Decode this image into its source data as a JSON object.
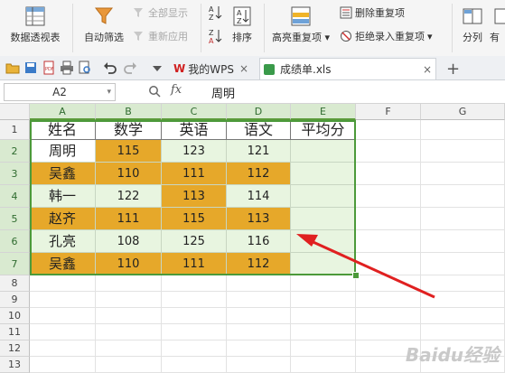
{
  "ribbon": {
    "pivot_label": "数据透视表",
    "autofilter_label": "自动筛选",
    "show_all_label": "全部显示",
    "reapply_label": "重新应用",
    "sort_label": "排序",
    "highlight_dup_label": "高亮重复项",
    "delete_dup_label": "删除重复项",
    "reject_dup_label": "拒绝录入重复项",
    "split_label": "分列",
    "truncated_label": "有"
  },
  "tabs": {
    "wps_tab": "我的WPS",
    "file_tab": "成绩单.xls",
    "file_close": "×",
    "wps_close": "×",
    "new_tab": "+"
  },
  "formula_bar": {
    "name_box": "A2",
    "fx": "fx",
    "value": "周明"
  },
  "columns": [
    "A",
    "B",
    "C",
    "D",
    "E",
    "F",
    "G"
  ],
  "rows": [
    "1",
    "2",
    "3",
    "4",
    "5",
    "6",
    "7",
    "8",
    "9",
    "10",
    "11",
    "12",
    "13"
  ],
  "sheet": {
    "header": [
      "姓名",
      "数学",
      "英语",
      "语文",
      "平均分"
    ],
    "data": [
      [
        "周明",
        "115",
        "123",
        "121",
        ""
      ],
      [
        "吴鑫",
        "110",
        "111",
        "112",
        ""
      ],
      [
        "韩一",
        "122",
        "113",
        "114",
        ""
      ],
      [
        "赵齐",
        "111",
        "115",
        "113",
        ""
      ],
      [
        "孔亮",
        "108",
        "125",
        "116",
        ""
      ],
      [
        "吴鑫",
        "110",
        "111",
        "112",
        ""
      ]
    ],
    "highlight": [
      [
        false,
        true,
        false,
        false,
        false
      ],
      [
        true,
        true,
        true,
        true,
        false
      ],
      [
        false,
        false,
        true,
        false,
        false
      ],
      [
        true,
        true,
        true,
        true,
        false
      ],
      [
        false,
        false,
        false,
        false,
        false
      ],
      [
        true,
        true,
        true,
        true,
        false
      ]
    ]
  },
  "colors": {
    "highlight": "#e6a82a",
    "selection": "#e8f5e0",
    "selection_border": "#4c9a3a",
    "arrow": "#e02020"
  },
  "watermark": "Baidu经验"
}
